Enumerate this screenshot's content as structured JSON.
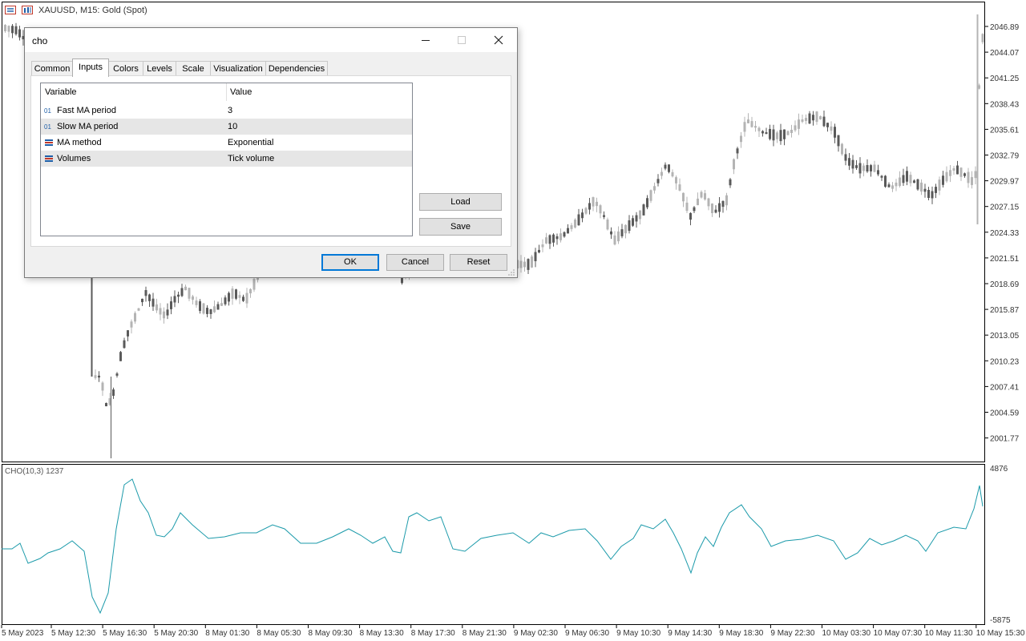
{
  "chart": {
    "symbol_title": "XAUUSD, M15:  Gold (Spot)",
    "price_labels": [
      "2046.89",
      "2044.07",
      "2041.25",
      "2038.43",
      "2035.61",
      "2032.79",
      "2029.97",
      "2027.15",
      "2024.33",
      "2021.51",
      "2018.69",
      "2015.87",
      "2013.05",
      "2010.23",
      "2007.41",
      "2004.59",
      "2001.77"
    ],
    "time_labels": [
      "5 May 2023",
      "5 May 12:30",
      "5 May 16:30",
      "5 May 20:30",
      "8 May 01:30",
      "8 May 05:30",
      "8 May 09:30",
      "8 May 13:30",
      "8 May 17:30",
      "8 May 21:30",
      "9 May 02:30",
      "9 May 06:30",
      "9 May 10:30",
      "9 May 14:30",
      "9 May 18:30",
      "9 May 22:30",
      "10 May 03:30",
      "10 May 07:30",
      "10 May 11:30",
      "10 May 15:30"
    ],
    "indicator_title": "CHO(10,3) 1237",
    "indicator_max": "4876",
    "indicator_min": "-5875",
    "up_color": "#b4b4b4",
    "down_color": "#5a5a5a",
    "line_color": "#1b9aaa"
  },
  "dialog": {
    "title": "cho",
    "tabs": [
      "Common",
      "Inputs",
      "Colors",
      "Levels",
      "Scale",
      "Visualization",
      "Dependencies"
    ],
    "active_tab": "Inputs",
    "columns": {
      "variable": "Variable",
      "value": "Value"
    },
    "rows": [
      {
        "variable": "Fast MA period",
        "value": "3",
        "icon": "integer-icon"
      },
      {
        "variable": "Slow MA period",
        "value": "10",
        "icon": "integer-icon"
      },
      {
        "variable": "MA method",
        "value": "Exponential",
        "icon": "enum-icon"
      },
      {
        "variable": "Volumes",
        "value": "Tick volume",
        "icon": "enum-icon"
      }
    ],
    "load_label": "Load",
    "save_label": "Save",
    "ok_label": "OK",
    "cancel_label": "Cancel",
    "reset_label": "Reset"
  }
}
